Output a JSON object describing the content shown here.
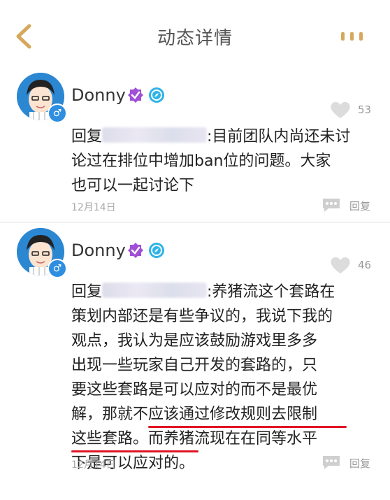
{
  "header": {
    "title": "动态详情",
    "back_icon": "chevron-left-icon",
    "more_icon": "more-icon",
    "accent": "#d6a85c"
  },
  "comments": [
    {
      "author": "Donny",
      "likes": "53",
      "reply_prefix": "回复",
      "body_line1": ":目前团队内尚还未讨",
      "body_line2": "论过在排位中增加ban位的问题。大家",
      "body_line3": "也可以一起讨论下",
      "date": "12月14日",
      "reply_label": "回复"
    },
    {
      "author": "Donny",
      "likes": "46",
      "reply_prefix": "回复",
      "body_line1": ":养猪流这个套路在",
      "body_line2": "策划内部还是有些争议的，我说下我的",
      "body_line3": "观点，我认为是应该鼓励游戏里多多",
      "body_line4": "出现一些玩家自己开发的套路的，只",
      "body_line5": "要这些套路是可以应对的而不是最优",
      "body_line6": "解，那就不应该通过修改规则去限制",
      "body_line7a": "这些套路。",
      "body_line7b": "而养猪流现在在同等水平",
      "body_line8": "下是可以应对的。",
      "date": "12月14日",
      "reply_label": "回复"
    }
  ],
  "colors": {
    "verified_purple": "#a04fd6",
    "badge_cyan": "#2fb3e8",
    "gender_blue": "#2f8ee0",
    "highlight_red": "#e01525"
  }
}
